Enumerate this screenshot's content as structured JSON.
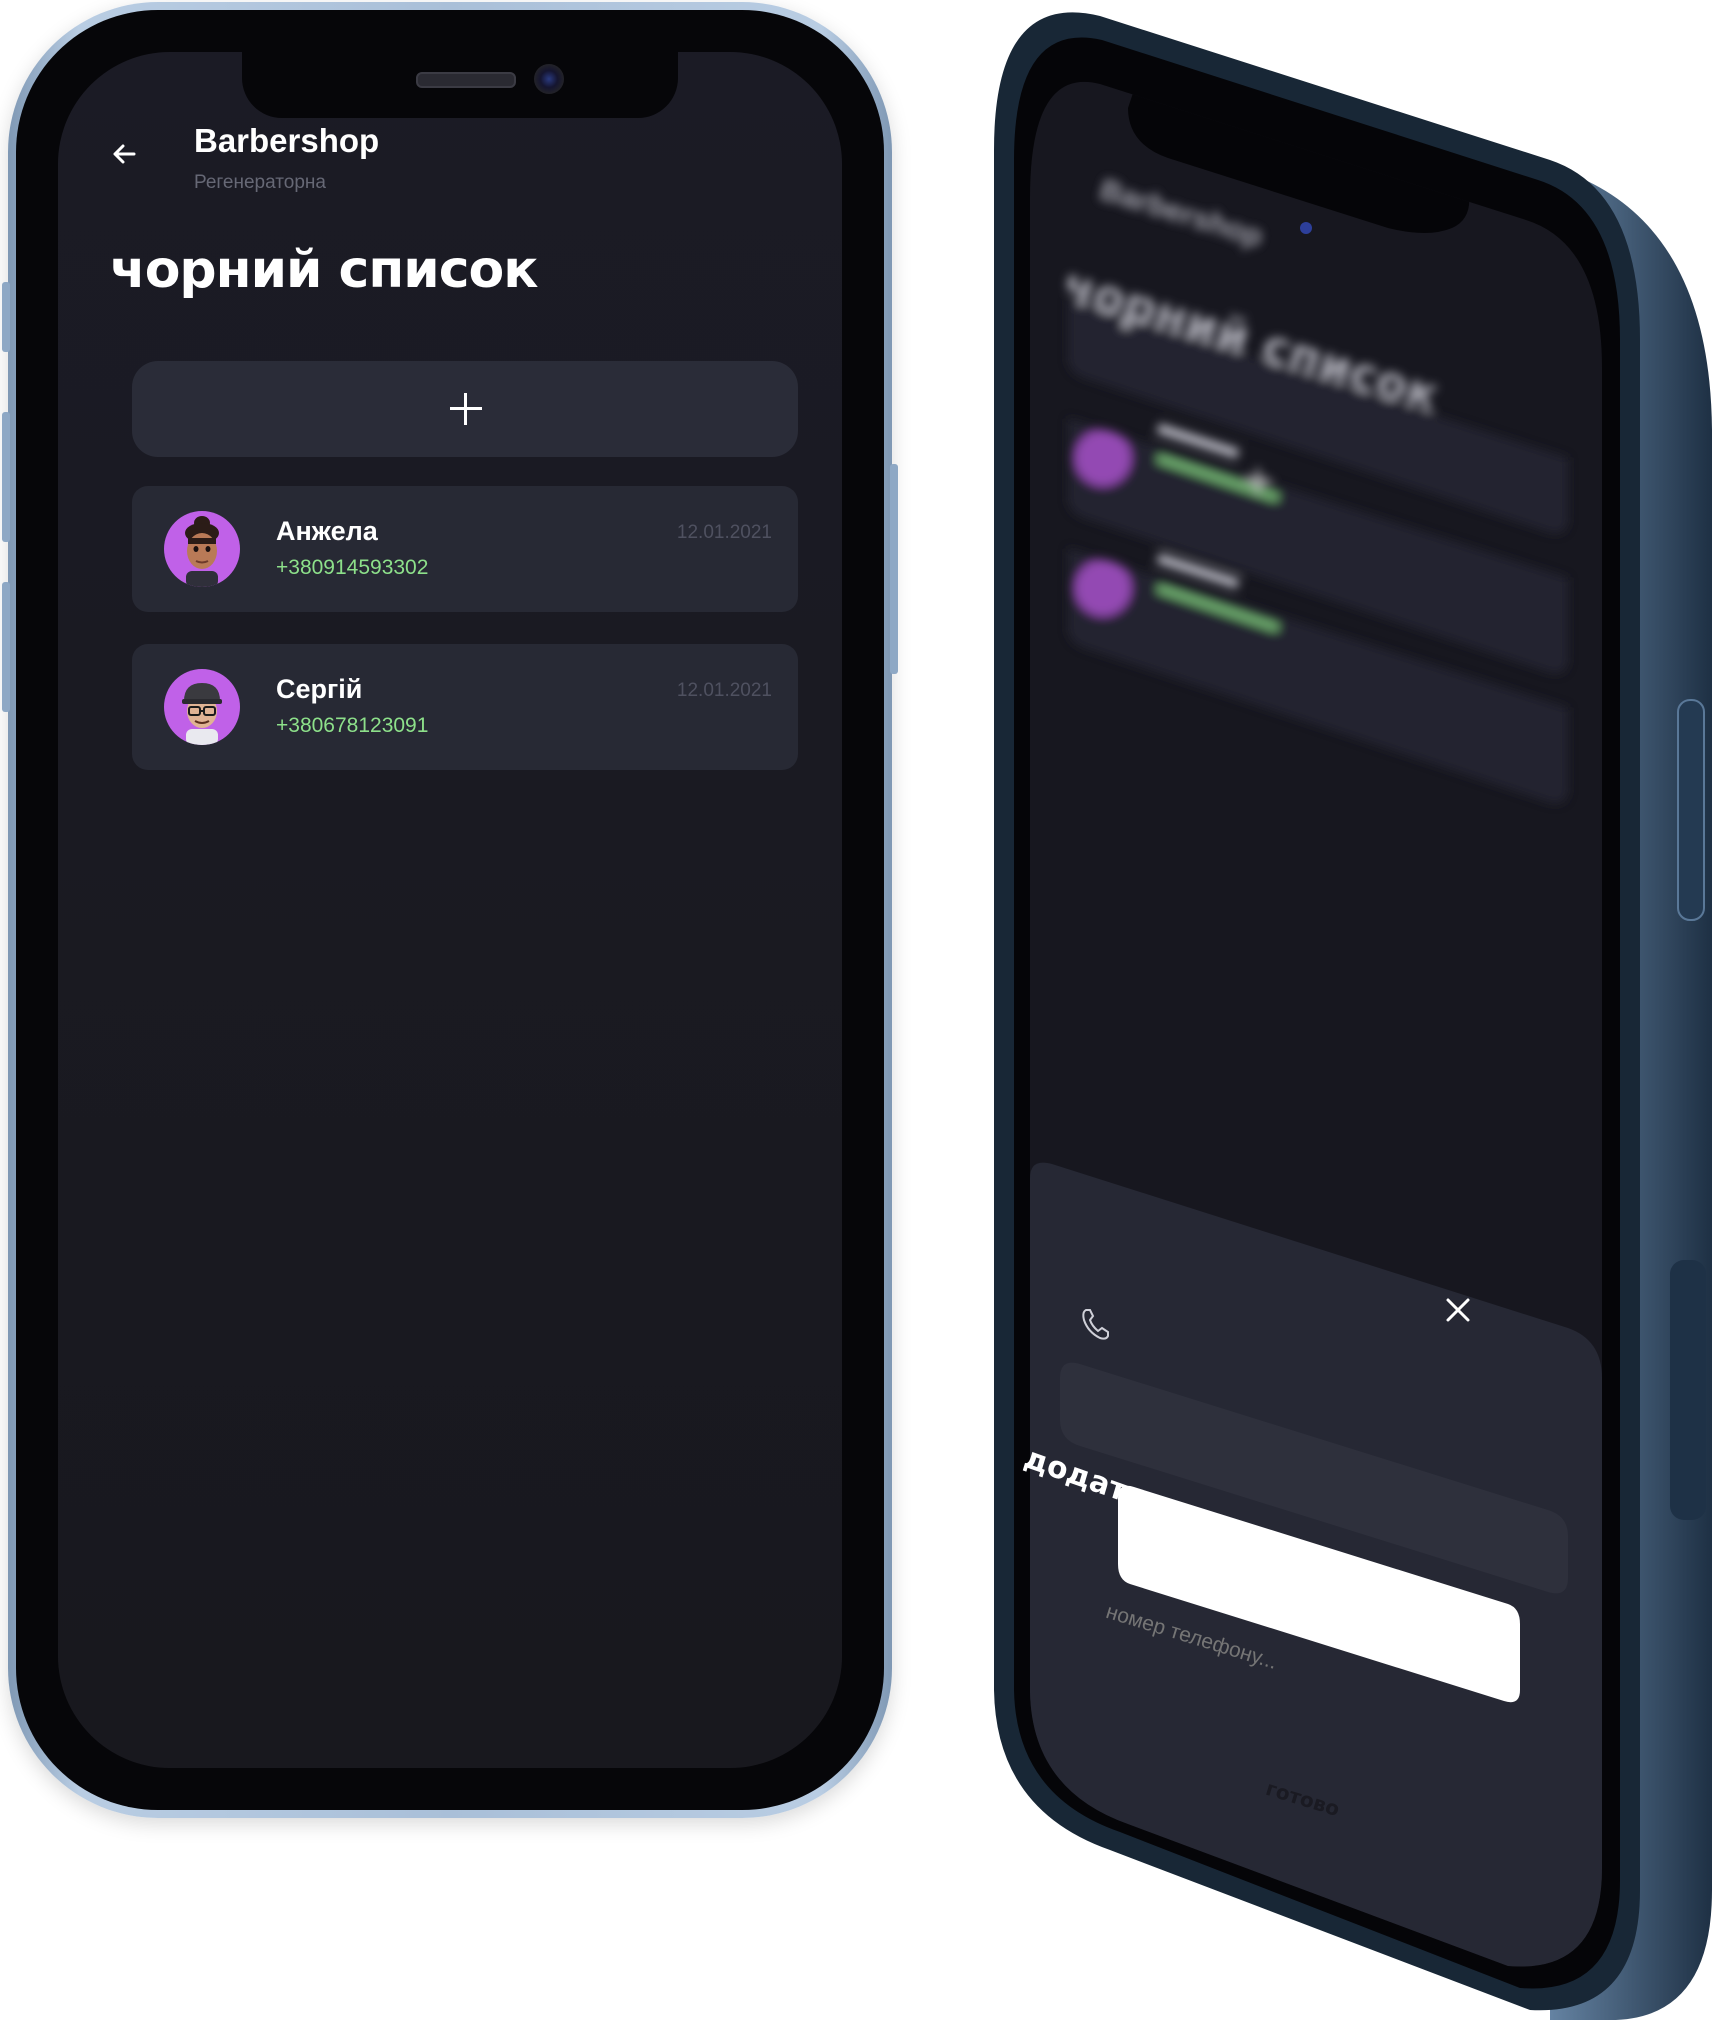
{
  "colors": {
    "screen_bg": "#1a1a22",
    "card_bg": "#272934",
    "accent_green": "#8de08a",
    "avatar_purple": "#c061e8",
    "frame_front": "#b9cde3",
    "frame_angled": "#2b4258"
  },
  "header": {
    "back_icon": "arrow-left-icon",
    "title": "Barbershop",
    "subtitle": "Регенераторна"
  },
  "page": {
    "title": "чорний список"
  },
  "add_button": {
    "icon": "plus-icon"
  },
  "contacts": [
    {
      "name": "Анжела",
      "phone": "+380914593302",
      "date": "12.01.2021",
      "avatar": "memoji-topknot"
    },
    {
      "name": "Сергій",
      "phone": "+380678123091",
      "date": "12.01.2021",
      "avatar": "memoji-cap-glasses"
    }
  ],
  "add_user_sheet": {
    "title": "додати користувача",
    "phone_icon": "phone-icon",
    "phone_placeholder": "номер телефону...",
    "close_icon": "close-icon",
    "done_label": "готово"
  }
}
